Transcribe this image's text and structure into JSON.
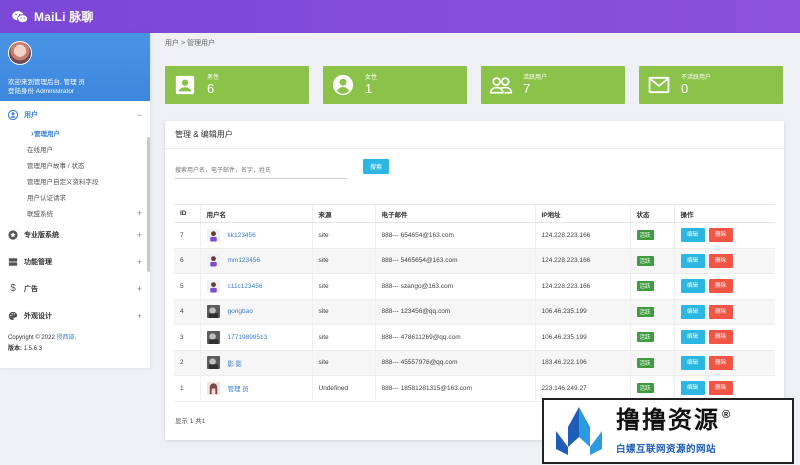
{
  "app": {
    "brand": "MaiLi 脉聊"
  },
  "profile": {
    "welcome": "欢迎来到管理后台, 管理 员",
    "role": "登陆身份 Administrator"
  },
  "menu": {
    "users": {
      "label": "用户",
      "toggle": "−"
    },
    "users_sub": [
      {
        "label": "管理用户",
        "current": true,
        "toggle": ""
      },
      {
        "label": "在线用户",
        "current": false,
        "toggle": ""
      },
      {
        "label": "管理用户故事 / 状态",
        "current": false,
        "toggle": ""
      },
      {
        "label": "管理用户自定义资料字段",
        "current": false,
        "toggle": ""
      },
      {
        "label": "用户认证请求",
        "current": false,
        "toggle": ""
      },
      {
        "label": "联盟系统",
        "current": false,
        "toggle": "+"
      }
    ],
    "groups": [
      {
        "label": "专业版系统",
        "toggle": "+",
        "icon": "star-icon"
      },
      {
        "label": "功能管理",
        "toggle": "+",
        "icon": "server-icon"
      },
      {
        "label": "广告",
        "toggle": "+",
        "icon": "dollar-icon"
      },
      {
        "label": "外观设计",
        "toggle": "+",
        "icon": "palette-icon"
      }
    ]
  },
  "footer": {
    "copyright": "Copyright © 2022",
    "link": "授西部.",
    "version_label": "版本:",
    "version": "1.5.6.3"
  },
  "breadcrumb": "用户 > 管理用户",
  "stats": [
    {
      "label": "男性",
      "value": "6",
      "icon": "portrait-icon"
    },
    {
      "label": "女性",
      "value": "1",
      "icon": "account-circle-icon"
    },
    {
      "label": "活跃用户",
      "value": "7",
      "icon": "group-icon"
    },
    {
      "label": "不活跃用户",
      "value": "0",
      "icon": "mail-icon"
    }
  ],
  "card": {
    "title": "管理 & 编辑用户",
    "search_placeholder": "搜索用户名，电子邮件，名字，姓氏",
    "search_button": "搜索",
    "footer": "显示 1 共1"
  },
  "table": {
    "headers": [
      "ID",
      "用户名",
      "来源",
      "电子邮件",
      "IP地址",
      "状态",
      "操作"
    ],
    "rows": [
      {
        "id": "7",
        "username": "kk123456",
        "source": "site",
        "email": "888--- 654654@163.com",
        "ip": "124.228.223.166",
        "status": "活跃",
        "edit": "编辑",
        "delete": "删除",
        "avatar": "default"
      },
      {
        "id": "6",
        "username": "mm123456",
        "source": "site",
        "email": "888--- 5465654@163.com",
        "ip": "124.228.223.166",
        "status": "活跃",
        "edit": "编辑",
        "delete": "删除",
        "avatar": "default"
      },
      {
        "id": "5",
        "username": "c11c123456",
        "source": "site",
        "email": "888--- szango@163.com",
        "ip": "124.228.223.166",
        "status": "活跃",
        "edit": "编辑",
        "delete": "删除",
        "avatar": "default"
      },
      {
        "id": "4",
        "username": "gongbao",
        "source": "site",
        "email": "888--- 123456@qq.com",
        "ip": "106.46.235.199",
        "status": "活跃",
        "edit": "编辑",
        "delete": "删除",
        "avatar": "photo"
      },
      {
        "id": "3",
        "username": "17719899513",
        "source": "site",
        "email": "888--- 478611269@qq.com",
        "ip": "106.46.235.199",
        "status": "活跃",
        "edit": "编辑",
        "delete": "删除",
        "avatar": "photo"
      },
      {
        "id": "2",
        "username": "影 影",
        "source": "site",
        "email": "888--- 45557976@qq.com",
        "ip": "183.46.222.106",
        "status": "活跃",
        "edit": "编辑",
        "delete": "删除",
        "avatar": "photo"
      },
      {
        "id": "1",
        "username": "管理 员",
        "source": "Undefined",
        "email": "888--- 18581281315@163.com",
        "ip": "223.146.249.27",
        "status": "活跃",
        "edit": "编辑",
        "delete": "删除",
        "avatar": "girl"
      }
    ]
  },
  "watermark": {
    "title": "撸撸资源",
    "reg": "®",
    "subtitle": "白嫖互联网资源的网站"
  },
  "colors": {
    "topbar": "#7b47d6",
    "profile": "#4a94e6",
    "stat": "#8bc34a",
    "link": "#3b7fd8",
    "edit": "#2bb7e2",
    "delete": "#f05545",
    "active_badge": "#3e9c3e"
  }
}
